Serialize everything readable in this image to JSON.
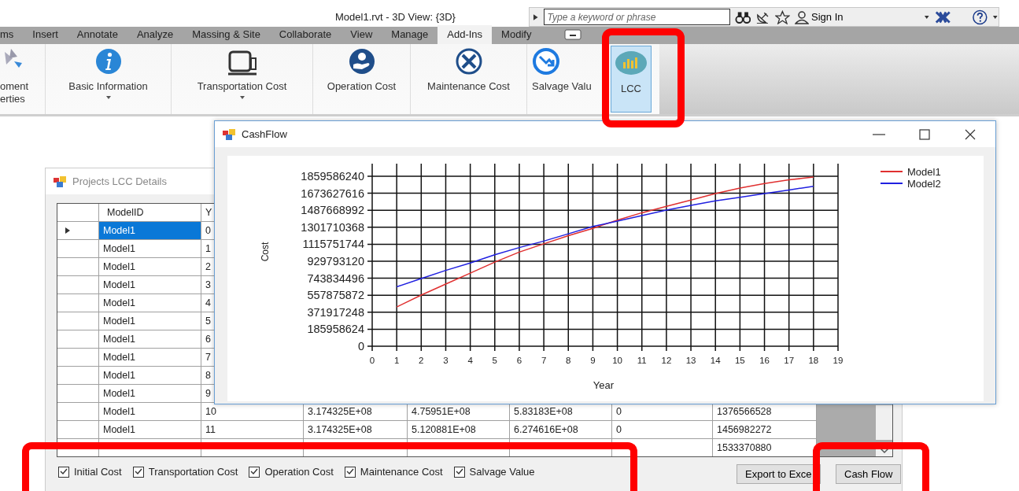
{
  "app_title": "Model1.rvt - 3D View: {3D}",
  "search": {
    "placeholder": "Type a keyword or phrase"
  },
  "sign_in": "Sign In",
  "ribbon_tabs": [
    {
      "label": "ms",
      "selected": false
    },
    {
      "label": "Insert",
      "selected": false
    },
    {
      "label": "Annotate",
      "selected": false
    },
    {
      "label": "Analyze",
      "selected": false
    },
    {
      "label": "Massing & Site",
      "selected": false
    },
    {
      "label": "Collaborate",
      "selected": false
    },
    {
      "label": "View",
      "selected": false
    },
    {
      "label": "Manage",
      "selected": false
    },
    {
      "label": "Add-Ins",
      "selected": true
    },
    {
      "label": "Modify",
      "selected": false
    }
  ],
  "ribbon_buttons": [
    {
      "kind": "equipment",
      "lines": [
        "oment",
        "erties"
      ],
      "dropdown": false,
      "selected": false
    },
    {
      "kind": "info",
      "lines": [
        "Basic Information"
      ],
      "dropdown": true,
      "selected": false
    },
    {
      "kind": "truck",
      "lines": [
        "Transportation Cost"
      ],
      "dropdown": true,
      "selected": false
    },
    {
      "kind": "money",
      "lines": [
        "Operation Cost"
      ],
      "dropdown": false,
      "selected": false
    },
    {
      "kind": "tools",
      "lines": [
        "Maintenance Cost"
      ],
      "dropdown": false,
      "selected": false
    },
    {
      "kind": "salvage",
      "lines": [
        "Salvage Valu"
      ],
      "dropdown": false,
      "selected": false
    },
    {
      "kind": "chart",
      "lines": [
        "LCC"
      ],
      "dropdown": false,
      "selected": true
    }
  ],
  "details_window": {
    "title": "Projects LCC Details",
    "columns": [
      "ModelID",
      "Y"
    ],
    "rows": [
      {
        "selected": true,
        "model_id": "Model1",
        "year": "0"
      },
      {
        "selected": false,
        "model_id": "Model1",
        "year": "1"
      },
      {
        "selected": false,
        "model_id": "Model1",
        "year": "2"
      },
      {
        "selected": false,
        "model_id": "Model1",
        "year": "3"
      },
      {
        "selected": false,
        "model_id": "Model1",
        "year": "4"
      },
      {
        "selected": false,
        "model_id": "Model1",
        "year": "5"
      },
      {
        "selected": false,
        "model_id": "Model1",
        "year": "6"
      },
      {
        "selected": false,
        "model_id": "Model1",
        "year": "7"
      },
      {
        "selected": false,
        "model_id": "Model1",
        "year": "8"
      },
      {
        "selected": false,
        "model_id": "Model1",
        "year": "9"
      },
      {
        "selected": false,
        "model_id": "Model1",
        "year": "10",
        "column_3": "3.174325E+08",
        "column_4": "4.75951E+08",
        "column_5": "5.83183E+08",
        "column_6": "0",
        "column_7": "1376566528"
      },
      {
        "selected": false,
        "model_id": "Model1",
        "year": "11",
        "column_3": "3.174325E+08",
        "column_4": "5.120881E+08",
        "column_5": "6.274616E+08",
        "column_6": "0",
        "column_7": "1456982272"
      },
      {
        "selected": false,
        "column_7": "1533370880"
      }
    ],
    "checkboxes": [
      {
        "label": "Initial Cost",
        "checked": true
      },
      {
        "label": "Transportation Cost",
        "checked": true
      },
      {
        "label": "Operation Cost",
        "checked": true
      },
      {
        "label": "Maintenance Cost",
        "checked": true
      },
      {
        "label": "Salvage Value",
        "checked": true
      }
    ],
    "buttons": [
      "Export to Exce",
      "Cash Flow"
    ]
  },
  "cashflow_window": {
    "title": "CashFlow",
    "chart_data": {
      "type": "line",
      "grid": true,
      "legend": true,
      "xlabel": "Year",
      "ylabel": "Cost",
      "xlim": [
        0,
        19
      ],
      "ylim": [
        0,
        1859586240
      ],
      "xticks": [
        0,
        1,
        2,
        3,
        4,
        5,
        6,
        7,
        8,
        9,
        10,
        11,
        12,
        13,
        14,
        15,
        16,
        17,
        18,
        19
      ],
      "yticks": [
        0,
        185958624,
        371917248,
        557875872,
        743834496,
        929793120,
        1115751744,
        1301710368,
        1487668992,
        1673627616,
        1859586240
      ],
      "x": [
        1,
        2,
        3,
        4,
        5,
        6,
        7,
        8,
        9,
        10,
        11,
        12,
        13,
        14,
        15,
        16,
        17,
        18
      ],
      "series": [
        {
          "name": "Model1",
          "color": "#e03030",
          "values": [
            430000000,
            560000000,
            680000000,
            800000000,
            920000000,
            1030000000,
            1120000000,
            1210000000,
            1290000000,
            1380000000,
            1460000000,
            1530000000,
            1600000000,
            1670000000,
            1730000000,
            1780000000,
            1820000000,
            1850000000
          ]
        },
        {
          "name": "Model2",
          "color": "#2020e0",
          "values": [
            650000000,
            740000000,
            830000000,
            910000000,
            1000000000,
            1080000000,
            1150000000,
            1230000000,
            1310000000,
            1370000000,
            1430000000,
            1490000000,
            1540000000,
            1590000000,
            1630000000,
            1670000000,
            1710000000,
            1750000000
          ]
        }
      ]
    }
  }
}
